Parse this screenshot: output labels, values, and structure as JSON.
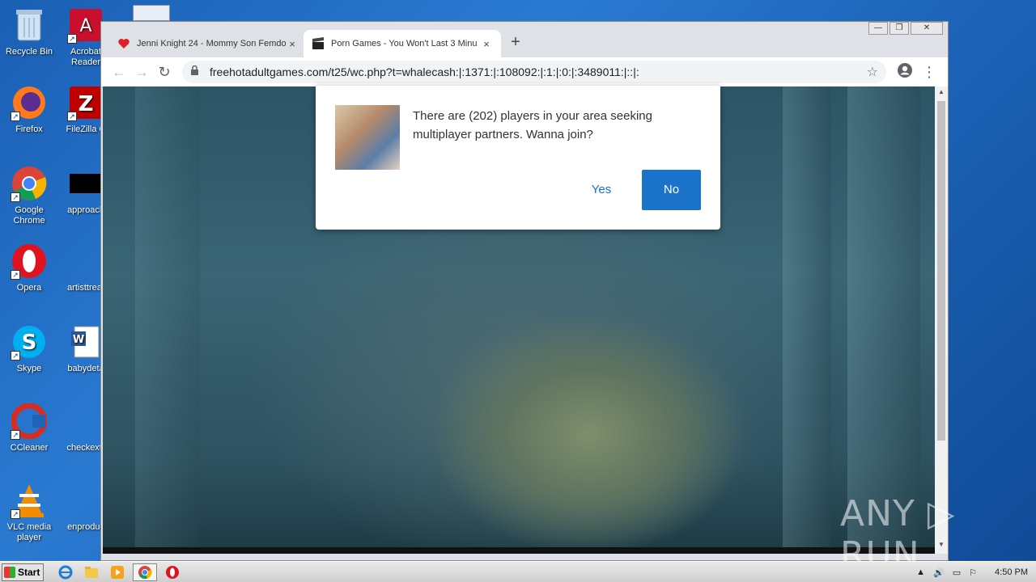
{
  "desktop": {
    "icons": [
      {
        "label": "Recycle Bin"
      },
      {
        "label": "Acrobat Reader"
      },
      {
        "label": "Firefox"
      },
      {
        "label": "FileZilla C"
      },
      {
        "label": "Google Chrome"
      },
      {
        "label": "approach"
      },
      {
        "label": "Opera"
      },
      {
        "label": "artisttreat"
      },
      {
        "label": "Skype"
      },
      {
        "label": "babydeta"
      },
      {
        "label": "CCleaner"
      },
      {
        "label": "checkextr"
      },
      {
        "label": "VLC media player"
      },
      {
        "label": "enproduc"
      }
    ]
  },
  "browser": {
    "tabs": [
      {
        "title": "Jenni Knight 24 - Mommy Son Femdo",
        "close": "×"
      },
      {
        "title": "Porn Games - You Won't Last 3 Minu",
        "close": "×"
      }
    ],
    "new_tab": "+",
    "window_controls": {
      "minimize": "—",
      "restore": "❐",
      "close": "✕"
    },
    "toolbar": {
      "back": "←",
      "forward": "→",
      "reload": "↻",
      "url": "freehotadultgames.com/t25/wc.php?t=whalecash:|:1371:|:108092:|:1:|:0:|:3489011:|::|:"
    }
  },
  "popup": {
    "message": "There are (202) players in your area seeking multiplayer partners. Wanna join?",
    "yes_label": "Yes",
    "no_label": "No"
  },
  "watermark": "ANY ▷ RUN",
  "taskbar": {
    "start_label": "Start",
    "clock": "4:50 PM"
  }
}
